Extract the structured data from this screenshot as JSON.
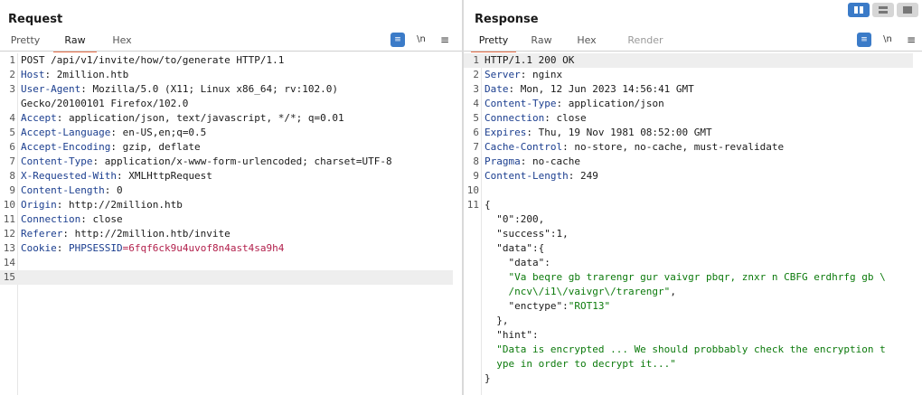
{
  "request": {
    "title": "Request",
    "tabs": [
      {
        "label": "Pretty",
        "state": "normal"
      },
      {
        "label": "Raw",
        "state": "active"
      },
      {
        "label": "Hex",
        "state": "normal"
      }
    ],
    "tools": {
      "pretty_icon": "format-icon",
      "newline_label": "\\n",
      "menu_icon": "hamburger-menu-icon"
    },
    "lines": [
      {
        "n": "1",
        "parts": [
          {
            "t": "POST /api/v1/invite/how/to/generate HTTP/1.1",
            "c": "v"
          }
        ]
      },
      {
        "n": "2",
        "parts": [
          {
            "t": "Host",
            "c": "k"
          },
          {
            "t": ": 2million.htb",
            "c": "v"
          }
        ]
      },
      {
        "n": "3",
        "parts": [
          {
            "t": "User-Agent",
            "c": "k"
          },
          {
            "t": ": Mozilla/5.0 (X11; Linux x86_64; rv:102.0)",
            "c": "v"
          }
        ]
      },
      {
        "n": "",
        "parts": [
          {
            "t": "Gecko/20100101 Firefox/102.0",
            "c": "v"
          }
        ]
      },
      {
        "n": "4",
        "parts": [
          {
            "t": "Accept",
            "c": "k"
          },
          {
            "t": ": application/json, text/javascript, */*; q=0.01",
            "c": "v"
          }
        ]
      },
      {
        "n": "5",
        "parts": [
          {
            "t": "Accept-Language",
            "c": "k"
          },
          {
            "t": ": en-US,en;q=0.5",
            "c": "v"
          }
        ]
      },
      {
        "n": "6",
        "parts": [
          {
            "t": "Accept-Encoding",
            "c": "k"
          },
          {
            "t": ": gzip, deflate",
            "c": "v"
          }
        ]
      },
      {
        "n": "7",
        "parts": [
          {
            "t": "Content-Type",
            "c": "k"
          },
          {
            "t": ": application/x-www-form-urlencoded; charset=UTF-8",
            "c": "v"
          }
        ]
      },
      {
        "n": "8",
        "parts": [
          {
            "t": "X-Requested-With",
            "c": "k"
          },
          {
            "t": ": XMLHttpRequest",
            "c": "v"
          }
        ]
      },
      {
        "n": "9",
        "parts": [
          {
            "t": "Content-Length",
            "c": "k"
          },
          {
            "t": ": 0",
            "c": "v"
          }
        ]
      },
      {
        "n": "10",
        "parts": [
          {
            "t": "Origin",
            "c": "k"
          },
          {
            "t": ": http://2million.htb",
            "c": "v"
          }
        ]
      },
      {
        "n": "11",
        "parts": [
          {
            "t": "Connection",
            "c": "k"
          },
          {
            "t": ": close",
            "c": "v"
          }
        ]
      },
      {
        "n": "12",
        "parts": [
          {
            "t": "Referer",
            "c": "k"
          },
          {
            "t": ": http://2million.htb/invite",
            "c": "v"
          }
        ]
      },
      {
        "n": "13",
        "parts": [
          {
            "t": "Cookie",
            "c": "k"
          },
          {
            "t": ": ",
            "c": "v"
          },
          {
            "t": "PHPSESSID",
            "c": "k"
          },
          {
            "t": "=6fqf6ck9u4uvof8n4ast4sa9h4",
            "c": "ck"
          }
        ]
      },
      {
        "n": "14",
        "parts": []
      },
      {
        "n": "15",
        "parts": [],
        "highlight": true
      }
    ]
  },
  "response": {
    "title": "Response",
    "tabs": [
      {
        "label": "Pretty",
        "state": "active"
      },
      {
        "label": "Raw",
        "state": "normal"
      },
      {
        "label": "Hex",
        "state": "normal"
      },
      {
        "label": "Render",
        "state": "disabled"
      }
    ],
    "tools": {
      "pretty_icon": "format-icon",
      "newline_label": "\\n",
      "menu_icon": "hamburger-menu-icon"
    },
    "lines": [
      {
        "n": "1",
        "parts": [
          {
            "t": "HTTP/1.1 200 OK",
            "c": "v"
          }
        ],
        "highlight": true
      },
      {
        "n": "2",
        "parts": [
          {
            "t": "Server",
            "c": "k"
          },
          {
            "t": ": nginx",
            "c": "v"
          }
        ]
      },
      {
        "n": "3",
        "parts": [
          {
            "t": "Date",
            "c": "k"
          },
          {
            "t": ": Mon, 12 Jun 2023 14:56:41 GMT",
            "c": "v"
          }
        ]
      },
      {
        "n": "4",
        "parts": [
          {
            "t": "Content-Type",
            "c": "k"
          },
          {
            "t": ": application/json",
            "c": "v"
          }
        ]
      },
      {
        "n": "5",
        "parts": [
          {
            "t": "Connection",
            "c": "k"
          },
          {
            "t": ": close",
            "c": "v"
          }
        ]
      },
      {
        "n": "6",
        "parts": [
          {
            "t": "Expires",
            "c": "k"
          },
          {
            "t": ": Thu, 19 Nov 1981 08:52:00 GMT",
            "c": "v"
          }
        ]
      },
      {
        "n": "7",
        "parts": [
          {
            "t": "Cache-Control",
            "c": "k"
          },
          {
            "t": ": no-store, no-cache, must-revalidate",
            "c": "v"
          }
        ]
      },
      {
        "n": "8",
        "parts": [
          {
            "t": "Pragma",
            "c": "k"
          },
          {
            "t": ": no-cache",
            "c": "v"
          }
        ]
      },
      {
        "n": "9",
        "parts": [
          {
            "t": "Content-Length",
            "c": "k"
          },
          {
            "t": ": 249",
            "c": "v"
          }
        ]
      },
      {
        "n": "10",
        "parts": []
      },
      {
        "n": "11",
        "parts": [
          {
            "t": "{",
            "c": "j"
          }
        ]
      },
      {
        "n": "",
        "parts": [
          {
            "t": "  \"0\"",
            "c": "jk"
          },
          {
            "t": ":200,",
            "c": "n"
          }
        ]
      },
      {
        "n": "",
        "parts": [
          {
            "t": "  \"success\"",
            "c": "jk"
          },
          {
            "t": ":1,",
            "c": "n"
          }
        ]
      },
      {
        "n": "",
        "parts": [
          {
            "t": "  \"data\"",
            "c": "jk"
          },
          {
            "t": ":{",
            "c": "j"
          }
        ]
      },
      {
        "n": "",
        "parts": [
          {
            "t": "    \"data\"",
            "c": "jk"
          },
          {
            "t": ":",
            "c": "j"
          }
        ]
      },
      {
        "n": "",
        "parts": [
          {
            "t": "    \"Va beqre gb trarengr gur vaivgr pbqr, znxr n CBFG erdhrfg gb \\",
            "c": "jsv"
          }
        ]
      },
      {
        "n": "",
        "parts": [
          {
            "t": "    /ncv\\/i1\\/vaivgr\\/trarengr\"",
            "c": "jsv"
          },
          {
            "t": ",",
            "c": "j"
          }
        ]
      },
      {
        "n": "",
        "parts": [
          {
            "t": "    \"enctype\"",
            "c": "jk"
          },
          {
            "t": ":",
            "c": "j"
          },
          {
            "t": "\"ROT13\"",
            "c": "jsv"
          }
        ]
      },
      {
        "n": "",
        "parts": [
          {
            "t": "  },",
            "c": "j"
          }
        ]
      },
      {
        "n": "",
        "parts": [
          {
            "t": "  \"hint\"",
            "c": "jk"
          },
          {
            "t": ":",
            "c": "j"
          }
        ]
      },
      {
        "n": "",
        "parts": [
          {
            "t": "  \"Data is encrypted ... We should probbably check the encryption t",
            "c": "jsv"
          }
        ]
      },
      {
        "n": "",
        "parts": [
          {
            "t": "  ype in order to decrypt it...\"",
            "c": "jsv"
          }
        ]
      },
      {
        "n": "",
        "parts": [
          {
            "t": "}",
            "c": "j"
          }
        ]
      }
    ]
  },
  "layout_buttons": [
    {
      "name": "layout-side-by-side-button",
      "state": "active"
    },
    {
      "name": "layout-stacked-button",
      "state": "normal"
    },
    {
      "name": "layout-single-button",
      "state": "normal"
    }
  ]
}
